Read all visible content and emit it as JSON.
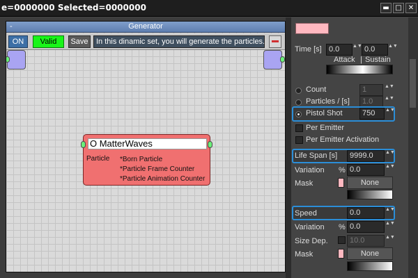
{
  "titlebar": {
    "text": "e=0000000  Selected=0000000",
    "btn_min": "▬",
    "btn_max": "□",
    "btn_close": "✕"
  },
  "generator": {
    "header_minus": "-",
    "title": "Generator",
    "on_label": "ON",
    "valid_label": "Valid",
    "save_label": "Save",
    "description": "In this dinamic set, you will generate the particles."
  },
  "node": {
    "title": "O MatterWaves",
    "row_label": "Particle",
    "lines": [
      "*Born Particle",
      "*Particle Frame Counter",
      "*Particle Animation Counter"
    ]
  },
  "panel": {
    "time_label": "Time [s]",
    "time_attack": "0.0",
    "time_sustain": "0.0",
    "attack_label": "Attack",
    "divider": "|",
    "sustain_label": "Sustain",
    "count_label": "Count",
    "count_value": "1",
    "particles_label": "Particles  /  [s]",
    "particles_value": "1.0",
    "pistol_label": "Pistol Shot",
    "pistol_value": "750",
    "per_emitter": "Per Emitter",
    "per_emitter_activation": "Per Emitter Activation",
    "life_span_label": "Life Span [s]",
    "life_span_value": "9999.0",
    "variation_label": "Variation",
    "percent": "%",
    "variation_value": "0.0",
    "mask_label": "Mask",
    "none_label": "None",
    "speed_label": "Speed",
    "speed_value": "0.0",
    "speed_variation_label": "Variation",
    "speed_percent": "%",
    "speed_variation_value": "0.0",
    "size_dep_label": "Size Dep.",
    "size_dep_value": "10.0",
    "speed_mask_label": "Mask",
    "speed_none_label": "None",
    "arrows": "▲▼"
  },
  "colors": {
    "accent_highlight": "#2b8ed8",
    "node_fill": "#f07070",
    "valid_green": "#19f519",
    "port_purple": "#a9a4f2",
    "swatch_pink": "#ffb8c0"
  }
}
